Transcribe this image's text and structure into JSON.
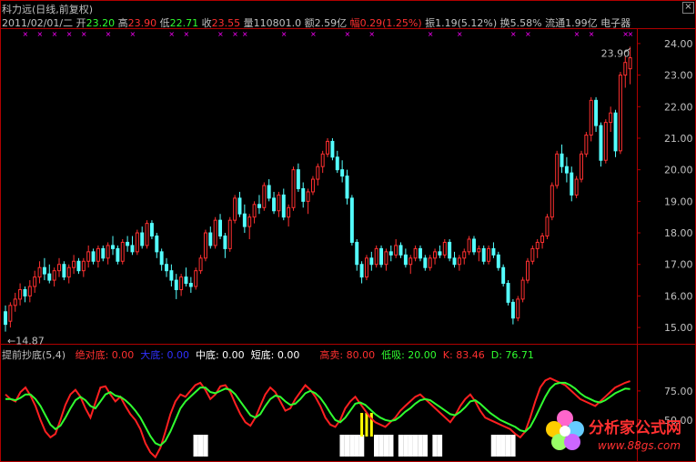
{
  "header": {
    "title": "科力远(日线,前复权)",
    "date": "2011/02/01/二",
    "open_label": "开",
    "open": "23.20",
    "high_label": "高",
    "high": "23.90",
    "low_label": "低",
    "low": "22.71",
    "close_label": "收",
    "close": "23.55",
    "volume_label": "量",
    "volume": "110801.0",
    "amount_label": "额",
    "amount": "2.59亿",
    "change_label": "幅",
    "change": "0.29(1.25%)",
    "amplitude_label": "振",
    "amplitude": "1.19(5.12%)",
    "turnover_label": "换",
    "turnover": "5.58%",
    "float_label": "流通",
    "float": "1.99亿",
    "sector": "电子器"
  },
  "indicator_header": {
    "name": "提前抄底(5,4)",
    "items": [
      {
        "label": "绝对底:",
        "value": "0.00",
        "color": "#ff3030"
      },
      {
        "label": "大底:",
        "value": "0.00",
        "color": "#3030ff"
      },
      {
        "label": "中底:",
        "value": "0.00",
        "color": "#ffffff"
      },
      {
        "label": "短底:",
        "value": "0.00",
        "color": "#ffffff"
      },
      {
        "label": "高卖:",
        "value": "80.00",
        "color": "#ff3030"
      },
      {
        "label": "低吸:",
        "value": "20.00",
        "color": "#30ff30"
      },
      {
        "label": "K:",
        "value": "83.46",
        "color": "#ff3030"
      },
      {
        "label": "D:",
        "value": "76.71",
        "color": "#30ff30"
      }
    ]
  },
  "watermark": {
    "title": "分析家公式网",
    "url": "www.88gs.com"
  },
  "colors": {
    "up": "#ff3030",
    "down": "#54ffff",
    "frame": "#b00000",
    "axis_text": "#c0c0c0",
    "k_line": "#ff2020",
    "d_line": "#30ff30",
    "marker": "#ff00ff",
    "signal_white": "#ffffff",
    "signal_yellow": "#ffff00"
  },
  "chart_data": [
    {
      "type": "candlestick",
      "ylim": [
        14.6,
        24.4
      ],
      "yticks": [
        "15.00",
        "16.00",
        "17.00",
        "18.00",
        "19.00",
        "20.00",
        "21.00",
        "22.00",
        "23.00",
        "24.00"
      ],
      "max_label": "23.90",
      "min_label": "14.87",
      "ohlc": [
        [
          15.5,
          15.7,
          14.87,
          15.1
        ],
        [
          15.2,
          15.8,
          15.0,
          15.7
        ],
        [
          15.7,
          16.1,
          15.5,
          15.9
        ],
        [
          15.9,
          16.4,
          15.7,
          16.2
        ],
        [
          16.2,
          16.3,
          15.8,
          16.0
        ],
        [
          16.0,
          16.5,
          15.8,
          16.3
        ],
        [
          16.3,
          16.8,
          16.1,
          16.6
        ],
        [
          16.6,
          17.1,
          16.4,
          16.9
        ],
        [
          16.9,
          17.2,
          16.5,
          16.7
        ],
        [
          16.7,
          17.0,
          16.4,
          16.5
        ],
        [
          16.5,
          16.9,
          16.3,
          16.8
        ],
        [
          16.8,
          17.2,
          16.6,
          17.0
        ],
        [
          17.0,
          17.1,
          16.5,
          16.6
        ],
        [
          16.6,
          17.0,
          16.4,
          16.9
        ],
        [
          16.9,
          17.3,
          16.7,
          17.1
        ],
        [
          17.1,
          17.2,
          16.7,
          16.8
        ],
        [
          16.8,
          17.2,
          16.6,
          17.1
        ],
        [
          17.1,
          17.6,
          16.9,
          17.4
        ],
        [
          17.4,
          17.5,
          17.0,
          17.1
        ],
        [
          17.1,
          17.6,
          16.9,
          17.5
        ],
        [
          17.5,
          17.6,
          17.1,
          17.2
        ],
        [
          17.2,
          17.7,
          17.0,
          17.6
        ],
        [
          17.6,
          17.9,
          17.3,
          17.5
        ],
        [
          17.5,
          17.6,
          17.0,
          17.1
        ],
        [
          17.1,
          17.8,
          17.0,
          17.7
        ],
        [
          17.7,
          17.9,
          17.4,
          17.6
        ],
        [
          17.6,
          17.9,
          17.3,
          17.4
        ],
        [
          17.4,
          18.1,
          17.3,
          18.0
        ],
        [
          18.0,
          18.2,
          17.5,
          17.6
        ],
        [
          17.6,
          18.4,
          17.5,
          18.3
        ],
        [
          18.3,
          18.4,
          17.8,
          17.9
        ],
        [
          17.9,
          18.0,
          17.2,
          17.4
        ],
        [
          17.4,
          17.5,
          16.8,
          17.0
        ],
        [
          17.0,
          17.2,
          16.6,
          16.8
        ],
        [
          16.8,
          17.0,
          16.3,
          16.5
        ],
        [
          16.5,
          16.7,
          15.9,
          16.2
        ],
        [
          16.2,
          16.7,
          16.0,
          16.6
        ],
        [
          16.6,
          16.9,
          16.3,
          16.4
        ],
        [
          16.4,
          16.6,
          16.1,
          16.3
        ],
        [
          16.3,
          16.9,
          16.2,
          16.8
        ],
        [
          16.8,
          17.3,
          16.7,
          17.2
        ],
        [
          17.2,
          18.1,
          17.1,
          18.0
        ],
        [
          18.0,
          18.2,
          17.5,
          17.6
        ],
        [
          17.6,
          18.5,
          17.5,
          18.4
        ],
        [
          18.4,
          18.6,
          17.8,
          17.9
        ],
        [
          17.9,
          18.0,
          17.2,
          17.5
        ],
        [
          17.5,
          18.5,
          17.4,
          18.4
        ],
        [
          18.4,
          19.2,
          18.3,
          19.1
        ],
        [
          19.1,
          19.3,
          18.5,
          18.6
        ],
        [
          18.6,
          18.9,
          18.0,
          18.2
        ],
        [
          18.2,
          18.6,
          17.8,
          18.5
        ],
        [
          18.5,
          19.0,
          18.3,
          18.9
        ],
        [
          18.9,
          19.2,
          18.6,
          18.8
        ],
        [
          18.8,
          19.6,
          18.7,
          19.5
        ],
        [
          19.5,
          19.7,
          19.0,
          19.1
        ],
        [
          19.1,
          19.3,
          18.6,
          18.7
        ],
        [
          18.7,
          19.3,
          18.5,
          19.2
        ],
        [
          19.2,
          19.4,
          18.4,
          18.5
        ],
        [
          18.5,
          18.9,
          18.2,
          18.8
        ],
        [
          18.8,
          20.1,
          18.7,
          20.0
        ],
        [
          20.0,
          20.2,
          19.3,
          19.4
        ],
        [
          19.4,
          19.6,
          18.8,
          19.0
        ],
        [
          19.0,
          19.4,
          18.6,
          19.3
        ],
        [
          19.3,
          19.8,
          19.2,
          19.7
        ],
        [
          19.7,
          20.2,
          19.5,
          20.1
        ],
        [
          20.1,
          20.6,
          19.9,
          20.5
        ],
        [
          20.5,
          21.0,
          20.4,
          20.9
        ],
        [
          20.9,
          21.0,
          20.3,
          20.4
        ],
        [
          20.4,
          20.6,
          19.9,
          20.0
        ],
        [
          20.0,
          20.3,
          19.6,
          19.8
        ],
        [
          19.8,
          20.0,
          18.9,
          19.1
        ],
        [
          19.1,
          19.2,
          17.6,
          17.7
        ],
        [
          17.7,
          17.8,
          16.8,
          17.0
        ],
        [
          17.0,
          17.1,
          16.4,
          16.6
        ],
        [
          16.6,
          17.3,
          16.5,
          17.2
        ],
        [
          17.2,
          17.4,
          16.8,
          17.0
        ],
        [
          17.0,
          17.6,
          16.9,
          17.5
        ],
        [
          17.5,
          17.6,
          16.9,
          17.0
        ],
        [
          17.0,
          17.5,
          16.8,
          17.4
        ],
        [
          17.4,
          17.6,
          17.1,
          17.3
        ],
        [
          17.3,
          17.8,
          17.2,
          17.6
        ],
        [
          17.6,
          17.7,
          17.2,
          17.3
        ],
        [
          17.3,
          17.5,
          16.9,
          17.0
        ],
        [
          17.0,
          17.3,
          16.7,
          17.2
        ],
        [
          17.2,
          17.6,
          17.1,
          17.5
        ],
        [
          17.5,
          17.6,
          17.1,
          17.2
        ],
        [
          17.2,
          17.3,
          16.8,
          16.9
        ],
        [
          16.9,
          17.3,
          16.8,
          17.2
        ],
        [
          17.2,
          17.5,
          17.0,
          17.4
        ],
        [
          17.4,
          17.6,
          17.2,
          17.3
        ],
        [
          17.3,
          17.8,
          17.2,
          17.7
        ],
        [
          17.7,
          17.8,
          17.1,
          17.2
        ],
        [
          17.2,
          17.4,
          16.9,
          17.0
        ],
        [
          17.0,
          17.3,
          16.8,
          17.2
        ],
        [
          17.2,
          17.5,
          17.0,
          17.4
        ],
        [
          17.4,
          17.9,
          17.3,
          17.8
        ],
        [
          17.8,
          17.9,
          17.3,
          17.4
        ],
        [
          17.4,
          17.6,
          17.1,
          17.5
        ],
        [
          17.5,
          17.6,
          17.0,
          17.1
        ],
        [
          17.1,
          17.6,
          17.0,
          17.5
        ],
        [
          17.5,
          17.7,
          17.2,
          17.3
        ],
        [
          17.3,
          17.4,
          16.8,
          16.9
        ],
        [
          16.9,
          17.0,
          16.3,
          16.4
        ],
        [
          16.4,
          16.5,
          15.7,
          15.8
        ],
        [
          15.8,
          15.9,
          15.1,
          15.3
        ],
        [
          15.3,
          16.0,
          15.2,
          15.9
        ],
        [
          15.9,
          16.6,
          15.8,
          16.5
        ],
        [
          16.5,
          17.2,
          16.4,
          17.1
        ],
        [
          17.1,
          17.6,
          17.0,
          17.5
        ],
        [
          17.5,
          17.8,
          17.2,
          17.7
        ],
        [
          17.7,
          18.0,
          17.5,
          17.9
        ],
        [
          17.9,
          18.6,
          17.8,
          18.5
        ],
        [
          18.5,
          19.6,
          18.4,
          19.5
        ],
        [
          19.5,
          20.6,
          19.4,
          20.5
        ],
        [
          20.5,
          20.8,
          19.9,
          20.1
        ],
        [
          20.1,
          20.4,
          19.6,
          19.9
        ],
        [
          19.9,
          20.1,
          19.0,
          19.2
        ],
        [
          19.2,
          19.8,
          19.1,
          19.7
        ],
        [
          19.7,
          20.6,
          19.6,
          20.5
        ],
        [
          20.5,
          21.2,
          20.4,
          21.1
        ],
        [
          21.1,
          22.3,
          20.9,
          22.2
        ],
        [
          22.2,
          22.3,
          21.2,
          21.4
        ],
        [
          21.4,
          21.5,
          20.1,
          20.3
        ],
        [
          20.3,
          21.6,
          20.2,
          21.5
        ],
        [
          21.5,
          22.0,
          21.2,
          21.8
        ],
        [
          21.8,
          21.9,
          20.4,
          20.6
        ],
        [
          20.6,
          23.1,
          20.5,
          23.0
        ],
        [
          23.0,
          23.6,
          22.6,
          23.4
        ],
        [
          23.2,
          23.9,
          22.71,
          23.55
        ]
      ]
    },
    {
      "type": "line",
      "ylim": [
        20,
        100
      ],
      "yticks": [
        "50.00",
        "75.00"
      ],
      "series": [
        {
          "name": "K",
          "values": [
            72,
            68,
            66,
            74,
            78,
            71,
            62,
            50,
            40,
            35,
            38,
            50,
            63,
            72,
            76,
            70,
            60,
            52,
            65,
            78,
            79,
            72,
            66,
            70,
            62,
            55,
            50,
            42,
            30,
            22,
            18,
            26,
            40,
            55,
            66,
            72,
            70,
            75,
            80,
            82,
            76,
            68,
            72,
            79,
            80,
            74,
            64,
            55,
            48,
            45,
            52,
            62,
            72,
            78,
            74,
            66,
            58,
            60,
            68,
            74,
            80,
            76,
            70,
            62,
            52,
            46,
            44,
            50,
            60,
            66,
            70,
            64,
            58,
            52,
            48,
            46,
            44,
            48,
            52,
            58,
            62,
            66,
            70,
            72,
            68,
            64,
            60,
            56,
            52,
            48,
            54,
            62,
            68,
            72,
            66,
            58,
            52,
            50,
            48,
            46,
            44,
            42,
            38,
            35,
            40,
            52,
            66,
            78,
            84,
            86,
            84,
            82,
            80,
            76,
            72,
            68,
            66,
            64,
            62,
            66,
            70,
            74,
            78,
            80,
            82,
            83.46
          ]
        },
        {
          "name": "D",
          "values": [
            68,
            68,
            67,
            69,
            72,
            72,
            68,
            62,
            54,
            46,
            42,
            45,
            52,
            60,
            67,
            70,
            67,
            62,
            60,
            66,
            72,
            74,
            71,
            70,
            67,
            63,
            58,
            52,
            44,
            36,
            30,
            28,
            32,
            40,
            50,
            60,
            66,
            70,
            74,
            78,
            78,
            74,
            73,
            75,
            77,
            76,
            72,
            66,
            60,
            54,
            52,
            55,
            62,
            68,
            71,
            70,
            66,
            63,
            64,
            68,
            73,
            75,
            73,
            69,
            63,
            56,
            50,
            48,
            52,
            58,
            64,
            65,
            63,
            59,
            55,
            52,
            50,
            49,
            50,
            53,
            57,
            60,
            64,
            67,
            68,
            67,
            64,
            61,
            58,
            55,
            54,
            57,
            61,
            66,
            67,
            64,
            60,
            56,
            53,
            50,
            48,
            46,
            44,
            41,
            40,
            44,
            52,
            61,
            70,
            77,
            81,
            82,
            82,
            80,
            77,
            73,
            70,
            68,
            66,
            65,
            67,
            70,
            73,
            75,
            77,
            76.71
          ]
        }
      ]
    }
  ]
}
